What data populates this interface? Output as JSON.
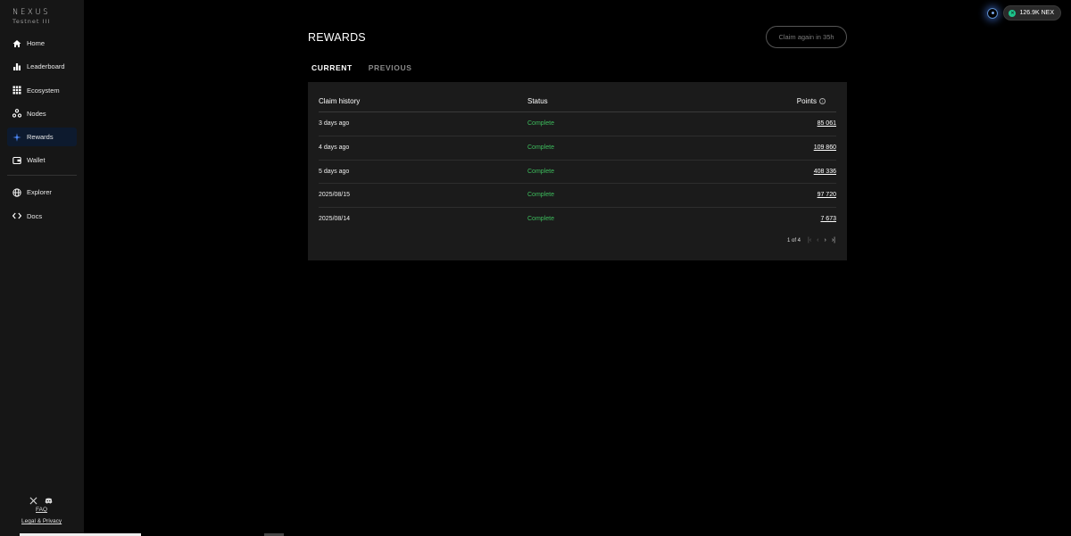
{
  "brand": {
    "name": "NEXUS",
    "subtitle": "Testnet III"
  },
  "nav": {
    "items": [
      {
        "label": "Home",
        "icon": "home-icon"
      },
      {
        "label": "Leaderboard",
        "icon": "bar-chart-icon"
      },
      {
        "label": "Ecosystem",
        "icon": "grid-icon"
      },
      {
        "label": "Nodes",
        "icon": "nodes-icon"
      },
      {
        "label": "Rewards",
        "icon": "sparkle-icon",
        "active": true
      },
      {
        "label": "Wallet",
        "icon": "wallet-icon"
      }
    ],
    "secondary": [
      {
        "label": "Explorer",
        "icon": "globe-icon"
      },
      {
        "label": "Docs",
        "icon": "code-icon"
      }
    ]
  },
  "footer": {
    "faq": "FAQ",
    "legal": "Legal & Privacy"
  },
  "topbar": {
    "balance": "126.9K NEX"
  },
  "page": {
    "title": "REWARDS",
    "claim_button": "Claim again in 35h",
    "tabs": {
      "current": "CURRENT",
      "previous": "PREVIOUS"
    }
  },
  "table": {
    "headers": {
      "history": "Claim history",
      "status": "Status",
      "points": "Points"
    },
    "rows": [
      {
        "date": "3 days ago",
        "status": "Complete",
        "points": "85 061"
      },
      {
        "date": "4 days ago",
        "status": "Complete",
        "points": "109 860"
      },
      {
        "date": "5 days ago",
        "status": "Complete",
        "points": "408 336"
      },
      {
        "date": "2025/08/15",
        "status": "Complete",
        "points": "97 720"
      },
      {
        "date": "2025/08/14",
        "status": "Complete",
        "points": "7 673"
      }
    ],
    "pagination": {
      "info": "1 of 4"
    }
  },
  "colors": {
    "accent": "#4f8cff",
    "status_complete": "#3dbd5d",
    "sidebar_bg": "#161616",
    "card_bg": "#1b1b1b"
  }
}
